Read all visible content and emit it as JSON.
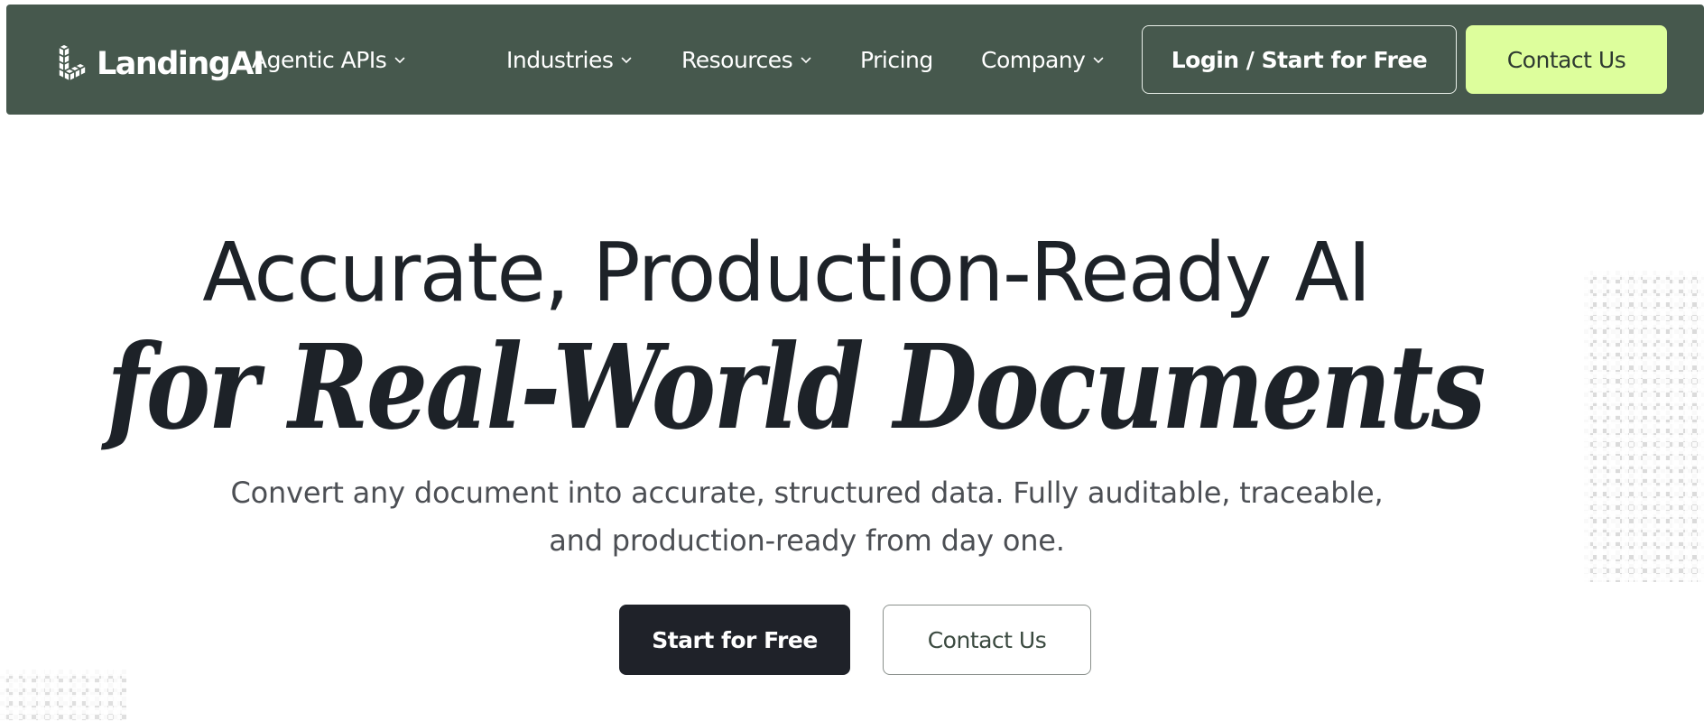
{
  "brand": {
    "name": "LandingAI",
    "logo_icon": "stacked-cubes-logo-icon"
  },
  "nav": {
    "items": [
      {
        "label": "Agentic APIs",
        "has_dropdown": true
      },
      {
        "label": "Industries",
        "has_dropdown": true
      },
      {
        "label": "Resources",
        "has_dropdown": true
      },
      {
        "label": "Pricing",
        "has_dropdown": false
      },
      {
        "label": "Company",
        "has_dropdown": true
      }
    ],
    "login_label": "Login / Start for Free",
    "contact_label": "Contact Us"
  },
  "hero": {
    "headline_line1": "Accurate, Production-Ready AI",
    "headline_line2": "for Real-World Documents",
    "subtitle": "Convert any document into accurate, structured data. Fully auditable, traceable, and production-ready from day one.",
    "primary_cta": "Start for Free",
    "secondary_cta": "Contact Us"
  },
  "colors": {
    "nav_background": "#46584d",
    "contact_button_accent": "#ddfe9c",
    "primary_button": "#1f2229",
    "headline_text": "#1d2228",
    "subtitle_text": "#4c4f54"
  }
}
